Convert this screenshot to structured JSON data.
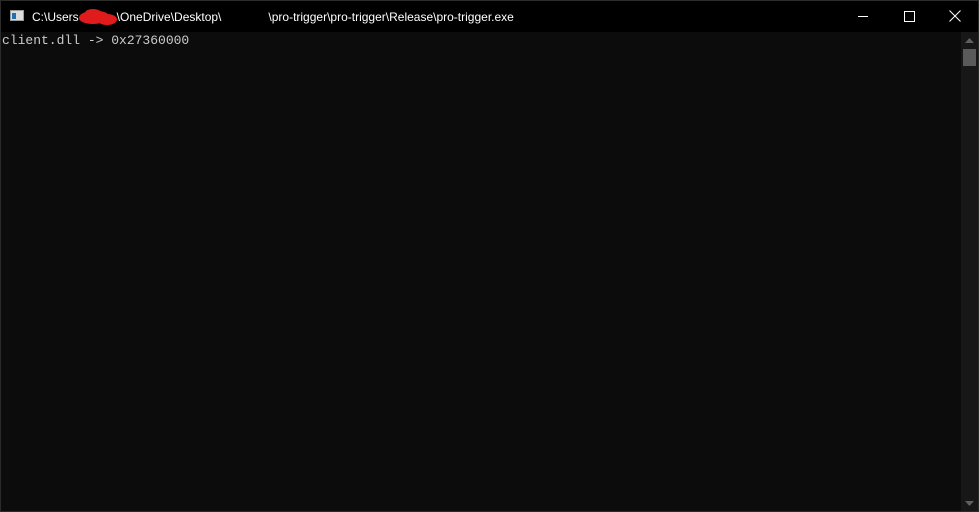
{
  "window": {
    "title_part1": "C:\\Users",
    "title_part2": "\\OneDrive\\Desktop\\",
    "title_part3": "\\pro-trigger\\pro-trigger\\Release\\pro-trigger.exe",
    "controls": [
      "minimize-icon",
      "maximize-icon",
      "close-icon"
    ]
  },
  "console": {
    "lines": [
      "client.dll -> 0x27360000"
    ],
    "background": "#0c0c0c",
    "text_color": "#cccccc"
  },
  "colors": {
    "titlebar": "#000000",
    "redaction": "#e01b1b",
    "scrollbar_track": "#171717",
    "scrollbar_thumb": "#5a5a5a"
  }
}
